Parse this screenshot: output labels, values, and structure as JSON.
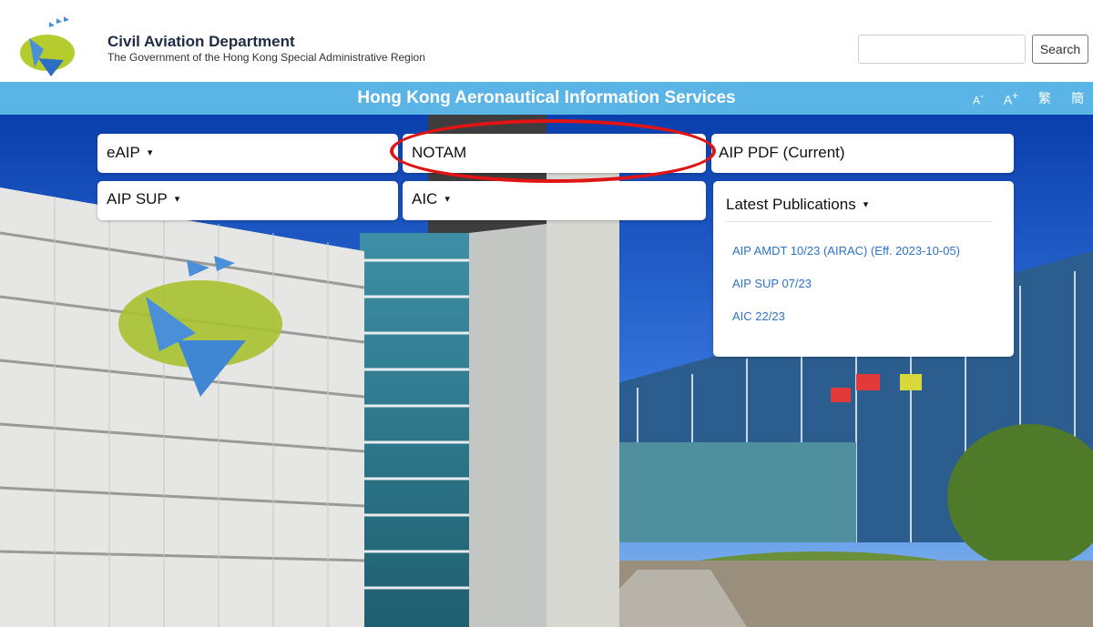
{
  "header": {
    "org_title": "Civil Aviation Department",
    "org_subtitle": "The Government of the Hong Kong Special Administrative Region",
    "search_placeholder": "",
    "search_label": "Search"
  },
  "banner": {
    "title": "Hong Kong Aeronautical Information Services",
    "controls": {
      "font_decrease": "A",
      "font_decrease_sup": "-",
      "font_increase": "A",
      "font_increase_sup": "+",
      "traditional": "繁",
      "simplified": "簡"
    }
  },
  "nav": {
    "eaip": "eAIP",
    "notam": "NOTAM",
    "aip_pdf": "AIP PDF (Current)",
    "aip_sup": "AIP SUP",
    "aic": "AIC",
    "caret": "▾"
  },
  "latest": {
    "heading": "Latest Publications",
    "links": [
      "AIP AMDT 10/23 (AIRAC) (Eff. 2023-10-05)",
      "AIP SUP 07/23",
      "AIC 22/23"
    ]
  },
  "colors": {
    "banner": "#5ab5e6",
    "link": "#2b73c7",
    "highlight": "#e01414"
  }
}
